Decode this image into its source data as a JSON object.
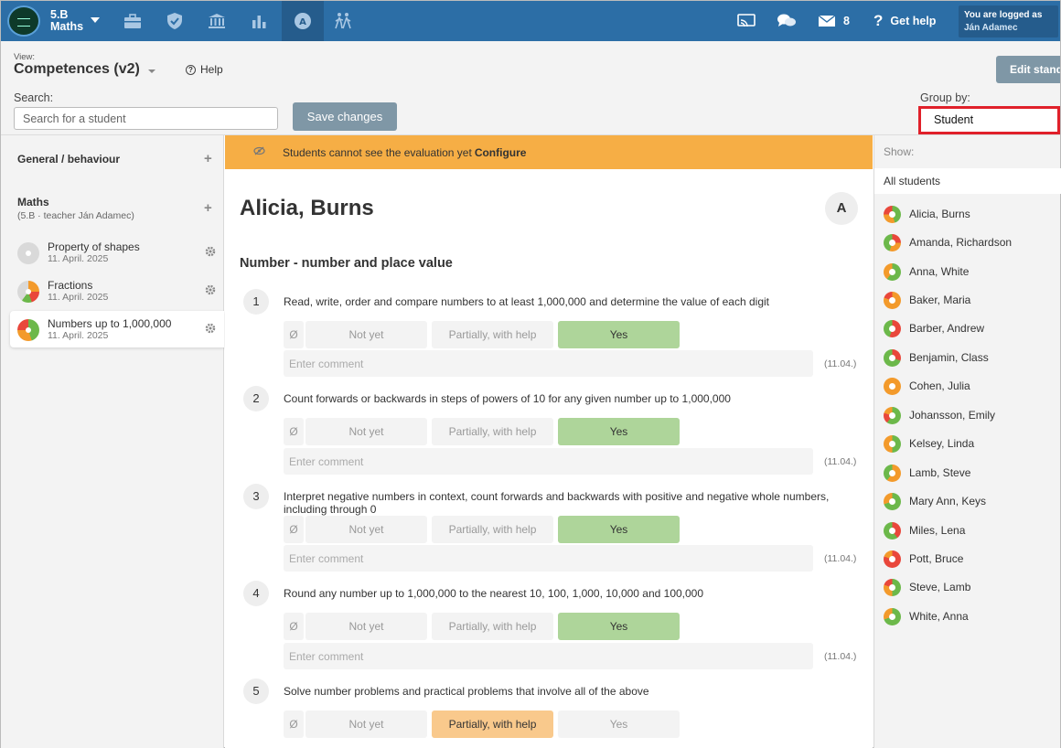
{
  "topbar": {
    "class_line1": "5.B",
    "class_line2": "Maths",
    "messages_count": "8",
    "get_help": "Get help",
    "logged_as_label": "You are logged as",
    "logged_user": "Ján Adamec"
  },
  "header": {
    "view_label": "View:",
    "view_value": "Competences (v2)",
    "help": "Help",
    "edit_button": "Edit standa",
    "search_label": "Search:",
    "search_placeholder": "Search for a student",
    "save_button": "Save changes",
    "group_by_label": "Group by:",
    "group_by_value": "Student"
  },
  "left": {
    "general_title": "General / behaviour",
    "maths_title": "Maths",
    "maths_sub": "(5.B · teacher Ján Adamec)",
    "assessments": [
      {
        "name": "Property of shapes",
        "date": "11. April. 2025"
      },
      {
        "name": "Fractions",
        "date": "11. April. 2025"
      },
      {
        "name": "Numbers up to 1,000,000",
        "date": "11. April. 2025"
      }
    ]
  },
  "center": {
    "banner_text": "Students cannot see the evaluation yet",
    "banner_link": "Configure",
    "student_name": "Alicia, Burns",
    "avatar_letter": "A",
    "topic": "Number - number and place value",
    "empty_symbol": "Ø",
    "opt_not_yet": "Not yet",
    "opt_partial": "Partially, with help",
    "opt_yes": "Yes",
    "comment_placeholder": "Enter comment",
    "comment_date": "(11.04.)",
    "criteria": [
      {
        "num": "1",
        "text": "Read, write, order and compare numbers to at least 1,000,000 and determine the value of each digit",
        "selected": "Yes"
      },
      {
        "num": "2",
        "text": "Count forwards or backwards in steps of powers of 10 for any given number up to 1,000,000",
        "selected": "Yes"
      },
      {
        "num": "3",
        "text": "Interpret negative numbers in context, count forwards and backwards with positive and negative whole numbers, including through 0",
        "selected": "Yes"
      },
      {
        "num": "4",
        "text": "Round any number up to 1,000,000 to the nearest 10, 100, 1,000, 10,000 and 100,000",
        "selected": "Yes"
      },
      {
        "num": "5",
        "text": "Solve number problems and practical problems that involve all of the above",
        "selected": "Partially, with help"
      }
    ]
  },
  "right": {
    "show_label": "Show:",
    "show_value": "All students",
    "students": [
      "Alicia, Burns",
      "Amanda, Richardson",
      "Anna, White",
      "Baker, Maria",
      "Barber, Andrew",
      "Benjamin, Class",
      "Cohen, Julia",
      "Johansson, Emily",
      "Kelsey, Linda",
      "Lamb, Steve",
      "Mary Ann, Keys",
      "Miles, Lena",
      "Pott, Bruce",
      "Steve, Lamb",
      "White, Anna"
    ]
  },
  "colors": {
    "topbar": "#2c6ea6",
    "banner": "#f6ae45",
    "yes": "#aed59a",
    "partial": "#f9c98c",
    "highlight_border": "#e0202a"
  }
}
